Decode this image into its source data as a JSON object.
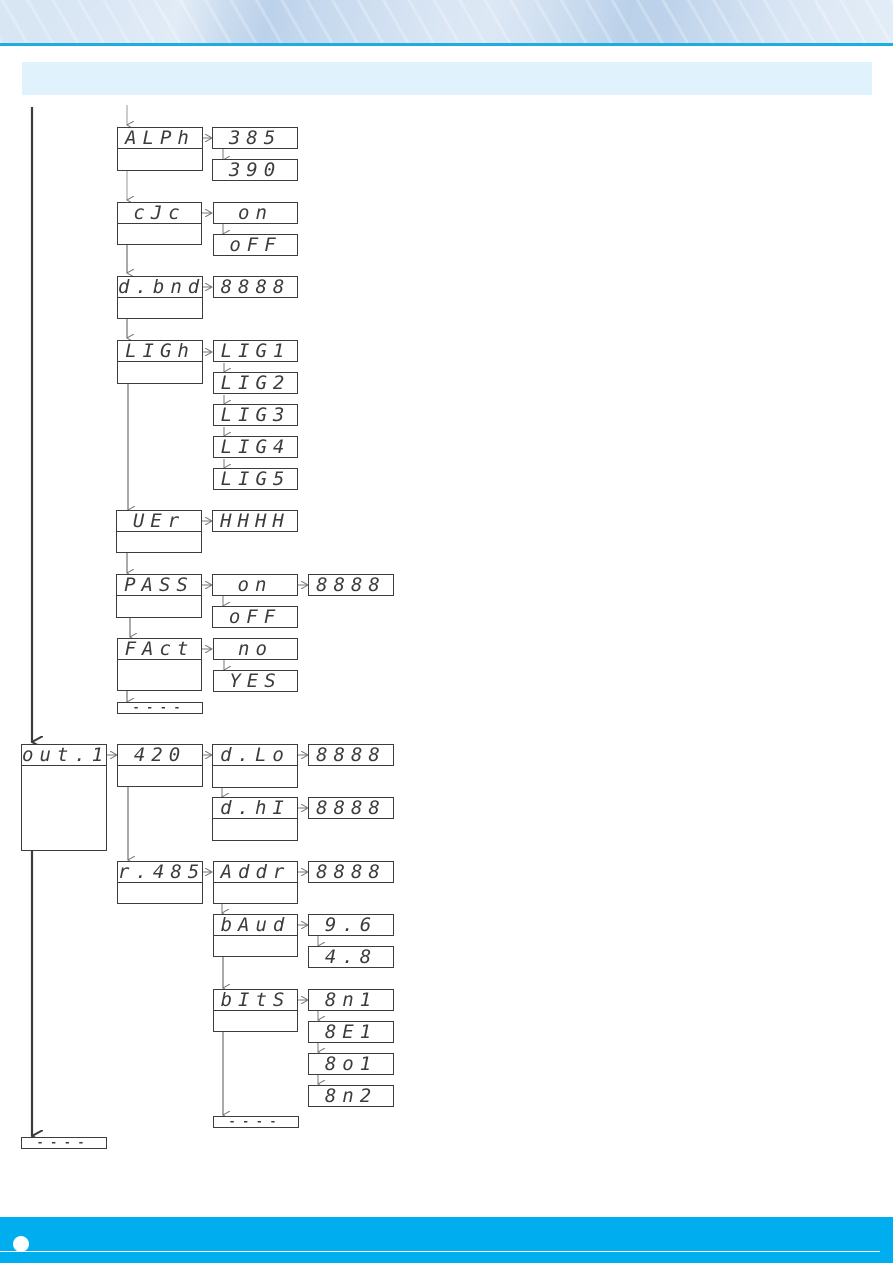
{
  "colors": {
    "accent": "#00adee",
    "header_rule": "#1aaee3",
    "title_band": "#e0f2fb",
    "line": "#3c3c3c"
  },
  "header": {
    "title_band_text": ""
  },
  "menu": {
    "setup_branch": {
      "items": [
        {
          "code": "ALPh",
          "options": [
            "385",
            "390"
          ]
        },
        {
          "code": "cJc",
          "options": [
            "on",
            "oFF"
          ]
        },
        {
          "code": "d.bnd",
          "options": [
            "8888"
          ]
        },
        {
          "code": "LIGh",
          "options": [
            "LIG1",
            "LIG2",
            "LIG3",
            "LIG4",
            "LIG5"
          ]
        },
        {
          "code": "UEr",
          "options": [
            "HHHH"
          ]
        },
        {
          "code": "PASS",
          "options": [
            "on",
            "oFF"
          ],
          "on_value": "8888"
        },
        {
          "code": "FAct",
          "options": [
            "no",
            "YES"
          ]
        }
      ],
      "end": "----"
    },
    "output_branch": {
      "code": "out.1",
      "sub": [
        {
          "code": "420",
          "items": [
            {
              "code": "d.Lo",
              "value": "8888"
            },
            {
              "code": "d.hI",
              "value": "8888"
            }
          ]
        },
        {
          "code": "r.485",
          "items": [
            {
              "code": "Addr",
              "value": "8888"
            },
            {
              "code": "bAud",
              "options": [
                "9.6",
                "4.8"
              ]
            },
            {
              "code": "bItS",
              "options": [
                "8n1",
                "8E1",
                "8o1",
                "8n2"
              ]
            }
          ],
          "end": "----"
        }
      ]
    },
    "end": "----"
  },
  "footer": {
    "page_indicator_icon": "page-dot-icon"
  }
}
